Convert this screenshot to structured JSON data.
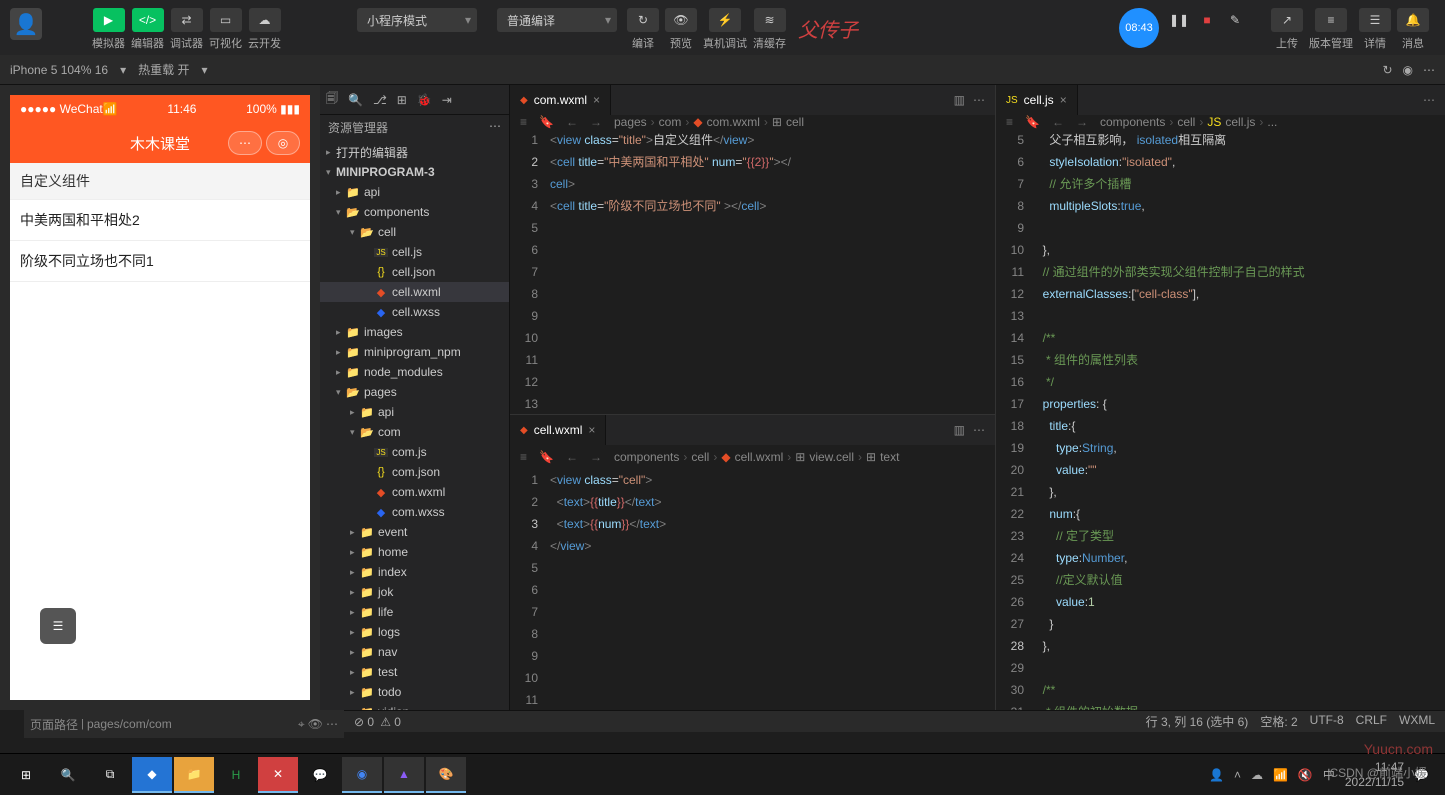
{
  "toolbar": {
    "simulator": "模拟器",
    "editor": "编辑器",
    "debugger": "调试器",
    "visual": "可视化",
    "cloud": "云开发",
    "mode_dropdown": "小程序模式",
    "compile_dropdown": "普通编译",
    "compile": "编译",
    "preview": "预览",
    "real_device": "真机调试",
    "clear_cache": "清缓存",
    "annotation": "父传子",
    "rec_time": "08:43",
    "upload": "上传",
    "version": "版本管理",
    "detail": "详情",
    "message": "消息"
  },
  "second_bar": {
    "device": "iPhone 5 104% 16",
    "hot_reload": "热重载 开"
  },
  "simulator": {
    "wechat": "WeChat",
    "time": "11:46",
    "battery": "100%",
    "app_title": "木木课堂",
    "section_title": "自定义组件",
    "row1": "中美两国和平相处2",
    "row2": "阶级不同立场也不同1",
    "footer_path_label": "页面路径",
    "footer_path": "pages/com/com"
  },
  "explorer": {
    "title": "资源管理器",
    "open_editors": "打开的编辑器",
    "project": "MINIPROGRAM-3",
    "tree": {
      "api": "api",
      "components": "components",
      "cell": "cell",
      "cell_js": "cell.js",
      "cell_json": "cell.json",
      "cell_wxml": "cell.wxml",
      "cell_wxss": "cell.wxss",
      "images": "images",
      "miniprogram_npm": "miniprogram_npm",
      "node_modules": "node_modules",
      "pages": "pages",
      "pages_api": "api",
      "com": "com",
      "com_js": "com.js",
      "com_json": "com.json",
      "com_wxml": "com.wxml",
      "com_wxss": "com.wxss",
      "event": "event",
      "home": "home",
      "index": "index",
      "jok": "jok",
      "life": "life",
      "logs": "logs",
      "nav": "nav",
      "test": "test",
      "todo": "todo",
      "yidian": "yidian"
    }
  },
  "editor1": {
    "tab": "com.wxml",
    "breadcrumb": [
      "pages",
      "com",
      "com.wxml",
      "cell"
    ],
    "code": {
      "l1_text": "自定义组件",
      "l2_title": "中美两国和平相处",
      "l2_num": "{{2}}",
      "l3_title": "阶级不同立场也不同"
    }
  },
  "editor2": {
    "tab": "cell.wxml",
    "breadcrumb": [
      "components",
      "cell",
      "cell.wxml",
      "view.cell",
      "text"
    ]
  },
  "editor3": {
    "tab": "cell.js",
    "breadcrumb": [
      "components",
      "cell",
      "cell.js",
      "..."
    ],
    "code": {
      "c1a": "父子相互影响，",
      "c1b": "相互隔离",
      "c2": "// 允许多个插槽",
      "c3": "// 通过组件的外部类实现父组件控制子自己的样式",
      "c4": " * 组件的属性列表",
      "c5": "// 定了类型",
      "c6": "//定义默认值",
      "c7": " * 组件的初始数据"
    }
  },
  "status": {
    "errors": "0",
    "warnings": "0",
    "line_col": "行 3, 列 16 (选中 6)",
    "spaces": "空格: 2",
    "encoding": "UTF-8",
    "eol": "CRLF",
    "lang": "WXML"
  },
  "taskbar": {
    "time": "11:47",
    "date": "2022/11/15",
    "ime": "中"
  },
  "watermark": "Yuucn.com",
  "csdn": "CSDN @前端小媛"
}
